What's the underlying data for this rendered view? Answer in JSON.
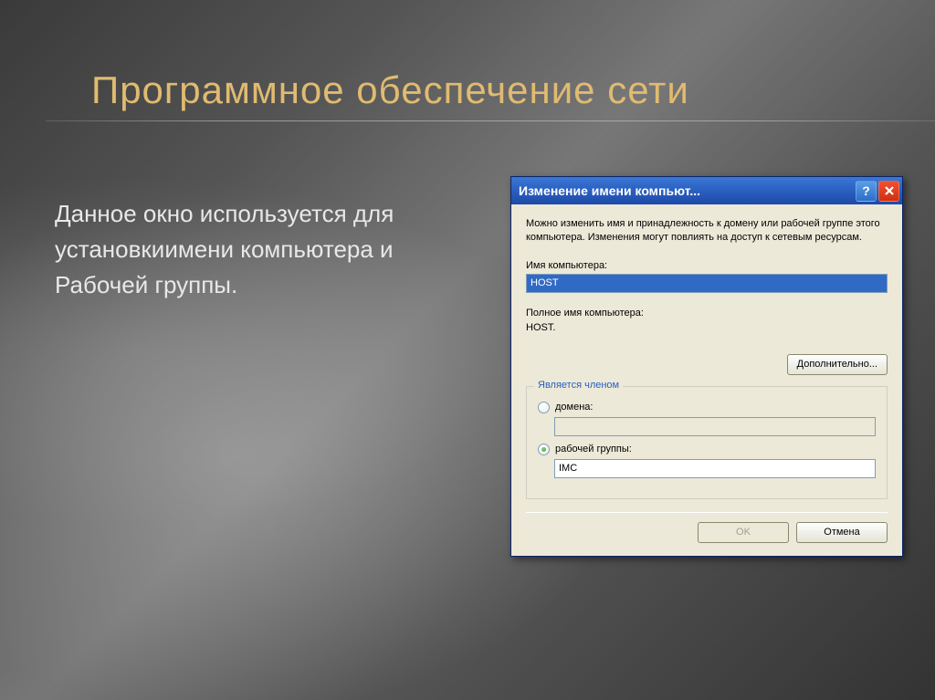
{
  "slide": {
    "title": "Программное обеспечение сети",
    "body_text": "Данное окно используется для установкиимени компьютера и Рабочей группы."
  },
  "dialog": {
    "title": "Изменение имени компьют...",
    "info_text": "Можно изменить имя и принадлежность к домену или рабочей группе этого компьютера. Изменения могут повлиять на доступ к сетевым ресурсам.",
    "computer_name_label": "Имя компьютера:",
    "computer_name_value": "HOST",
    "full_name_label": "Полное имя компьютера:",
    "full_name_value": "HOST.",
    "additional_button": "Дополнительно...",
    "fieldset_legend": "Является членом",
    "radio_domain": "домена:",
    "domain_value": "",
    "radio_workgroup": "рабочей группы:",
    "workgroup_value": "IMC",
    "ok_button": "OK",
    "cancel_button": "Отмена"
  }
}
